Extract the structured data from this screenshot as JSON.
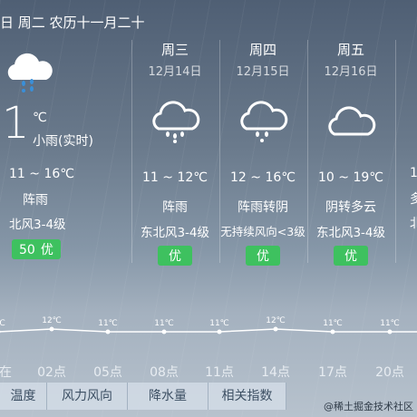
{
  "header": {
    "date_line": "日 周二 农历十一月二十"
  },
  "today": {
    "icon": "cloud-rain-icon",
    "temp": "1",
    "unit": "℃",
    "now_condition": "小雨(实时)",
    "range": "11 ~ 16℃",
    "condition": "阵雨",
    "wind": "北风3-4级",
    "aqi_value": "50",
    "aqi_label": "优"
  },
  "days": [
    {
      "weekday": "周三",
      "date": "12月14日",
      "icon": "cloud-rain-icon",
      "range": "11 ~ 12℃",
      "condition": "阵雨",
      "wind": "东北风3-4级",
      "aqi": "优"
    },
    {
      "weekday": "周四",
      "date": "12月15日",
      "icon": "cloud-rain-icon",
      "range": "12 ~ 16℃",
      "condition": "阵雨转阴",
      "wind": "无持续风向<3级",
      "aqi": "优"
    },
    {
      "weekday": "周五",
      "date": "12月16日",
      "icon": "cloud-icon",
      "range": "10 ~ 19℃",
      "condition": "阴转多云",
      "wind": "东北风3-4级",
      "aqi": "优"
    }
  ],
  "partial_next": {
    "range": "1",
    "condition": "多",
    "wind": "北"
  },
  "chart_data": {
    "type": "line",
    "x": [
      "现在",
      "02点",
      "05点",
      "08点",
      "11点",
      "14点",
      "17点",
      "20点"
    ],
    "values": [
      11,
      12,
      11,
      11,
      11,
      12,
      11,
      11
    ],
    "point_labels": [
      "1℃",
      "12℃",
      "11℃",
      "11℃",
      "11℃",
      "12℃",
      "11℃",
      "11℃"
    ],
    "x_tick_labels": [
      "在",
      "02点",
      "05点",
      "08点",
      "11点",
      "14点",
      "17点",
      "20点"
    ]
  },
  "tabs": [
    "温度",
    "风力风向",
    "降水量",
    "相关指数"
  ],
  "watermark": "@稀土掘金技术社区"
}
